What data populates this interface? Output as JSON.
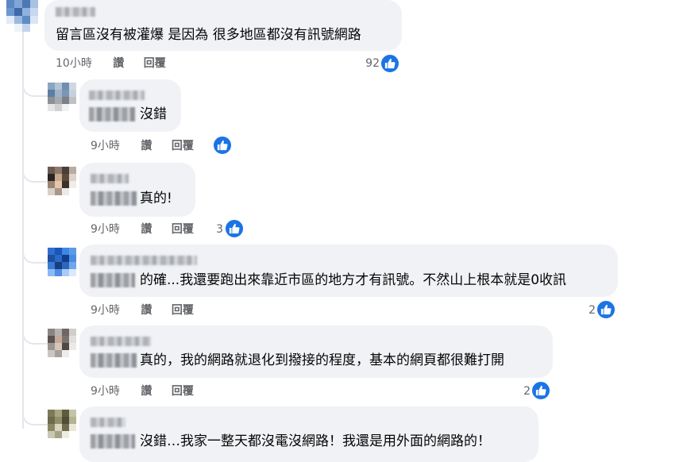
{
  "comments": [
    {
      "text": "留言區沒有被灌爆 是因為 很多地區都沒有訊號網路",
      "time": "10小時",
      "like_label": "讚",
      "reply_label": "回覆",
      "reaction_count": "92"
    },
    {
      "text": "沒錯",
      "time": "9小時",
      "like_label": "讚",
      "reply_label": "回覆",
      "reaction_count": ""
    },
    {
      "text": "真的!",
      "time": "9小時",
      "like_label": "讚",
      "reply_label": "回覆",
      "reaction_count": "3"
    },
    {
      "text": "的確...我還要跑出來靠近市區的地方才有訊號。不然山上根本就是0收訊",
      "time": "9小時",
      "like_label": "讚",
      "reply_label": "回覆",
      "reaction_count": "2"
    },
    {
      "text": "真的，我的網路就退化到撥接的程度，基本的網頁都很難打開",
      "time": "9小時",
      "like_label": "讚",
      "reply_label": "回覆",
      "reaction_count": "2"
    },
    {
      "text": "沒錯…我家一整天都沒電沒網路！我還是用外面的網路的！",
      "time": "",
      "like_label": "",
      "reply_label": "",
      "reaction_count": ""
    }
  ],
  "icons": {
    "reaction": "like-thumbs-up-icon",
    "reaction_color": "#1b74e4"
  }
}
